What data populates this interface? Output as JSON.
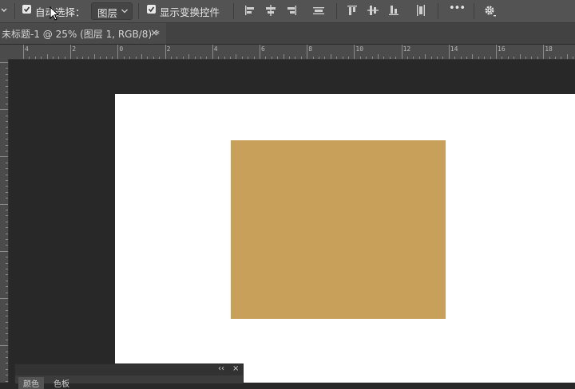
{
  "options_bar": {
    "auto_select_label": "自动选择：",
    "auto_select_checked": true,
    "auto_select_target": "图层",
    "show_transform_label": "显示变换控件",
    "show_transform_checked": true,
    "more_label": "•••"
  },
  "document_tab": {
    "title": "未标题-1 @ 25% (图层 1, RGB/8) *",
    "close_glyph": "×"
  },
  "ruler": {
    "h_labels": [
      "4",
      "2",
      "0",
      "2",
      "4",
      "6",
      "8",
      "10",
      "12",
      "14",
      "16",
      "18"
    ]
  },
  "canvas": {
    "background": "#ffffff",
    "shape_color": "#c9a05a"
  },
  "panel": {
    "collapse_glyph": "‹‹",
    "close_glyph": "×",
    "tabs": [
      "颜色",
      "色板"
    ]
  }
}
